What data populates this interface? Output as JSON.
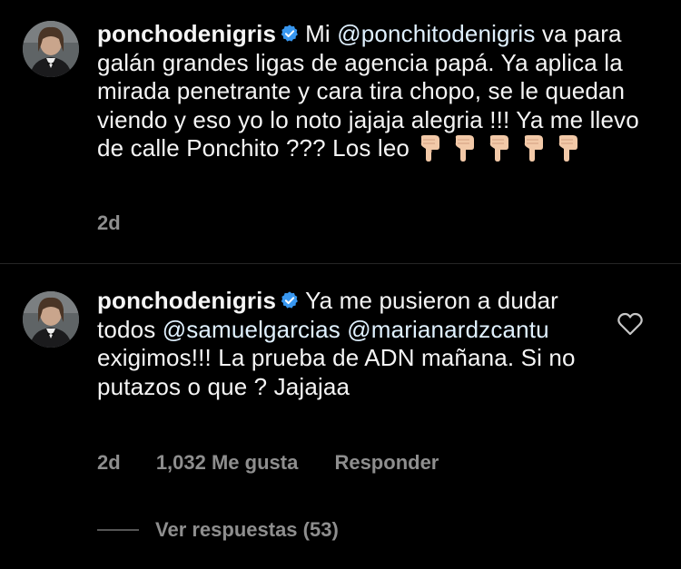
{
  "comments": [
    {
      "username": "ponchodenigris",
      "verified": true,
      "text_parts": {
        "a": "Mi ",
        "mention1": "@ponchitodenigris",
        "b": " va para galán grandes ligas de agencia papá. Ya aplica la mirada penetrante y cara tira chopo, se le quedan viendo y eso yo lo noto jajaja alegria !!! Ya me llevo de calle Ponchito ??? Los leo"
      },
      "emojis": [
        "pointing-down-emoji",
        "pointing-down-emoji",
        "pointing-down-emoji",
        "pointing-down-emoji",
        "pointing-down-emoji"
      ],
      "time": "2d"
    },
    {
      "username": "ponchodenigris",
      "verified": true,
      "text_parts": {
        "a": "Ya me pusieron a dudar todos ",
        "mention1": "@samuelgarcias",
        "b": " ",
        "mention2": "@marianardzcantu",
        "c": " exigimos!!! La prueba de ADN mañana. Si no putazos o que ? Jajajaa"
      },
      "time": "2d",
      "likes": "1,032 Me gusta",
      "reply_label": "Responder",
      "view_replies": "Ver respuestas (53)"
    }
  ],
  "colors": {
    "background": "#000000",
    "text": "#f5f5f5",
    "secondary": "#8e8e8e",
    "verified": "#3897f0",
    "divider": "#262626"
  }
}
